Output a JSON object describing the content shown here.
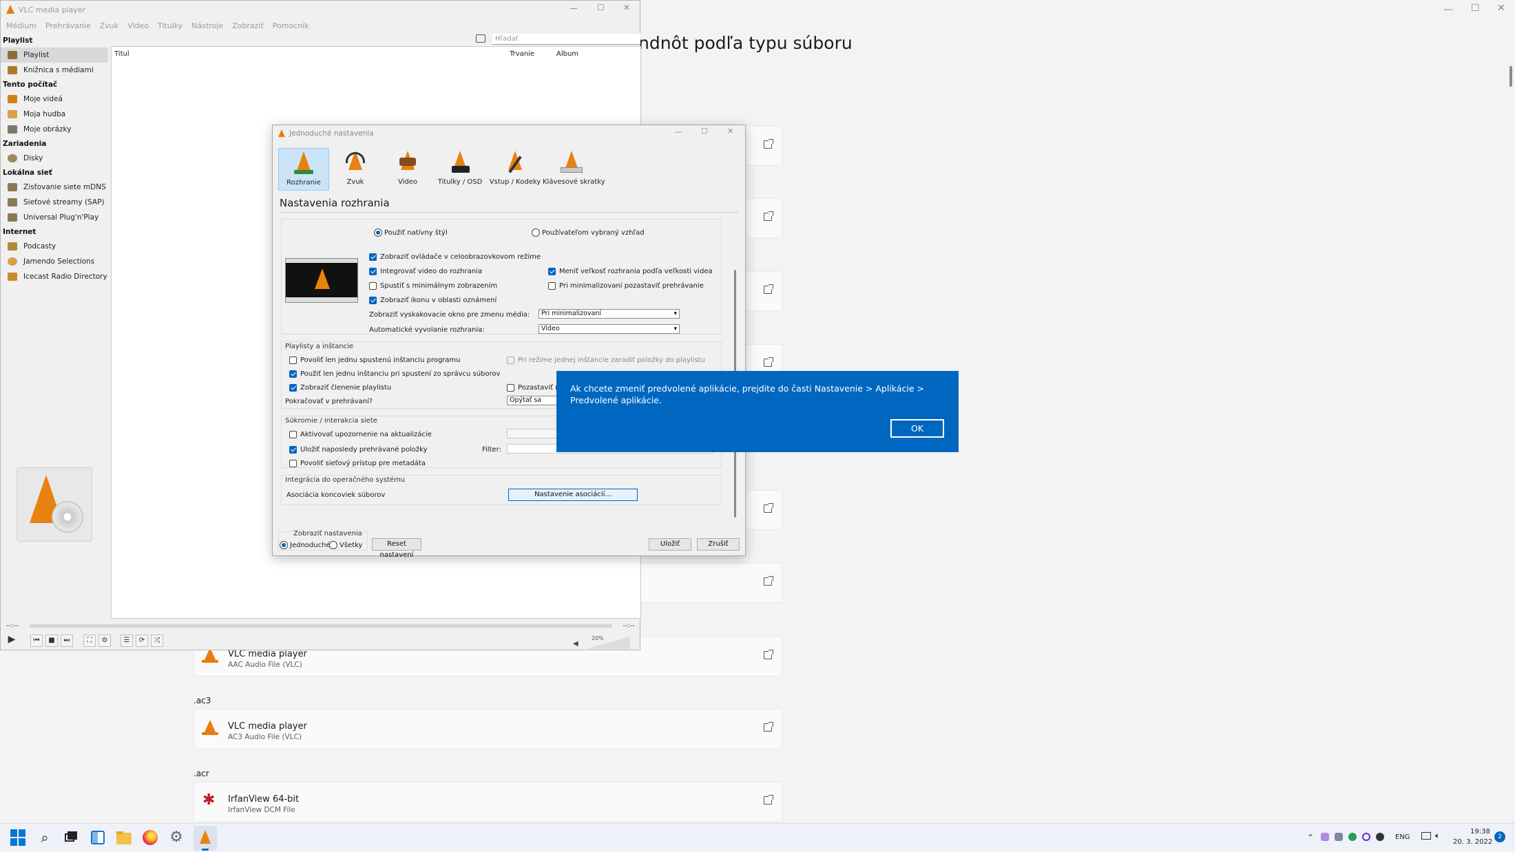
{
  "settings_bg": {
    "title": "ndnôt podľa typu súboru",
    "rows": [
      {
        "type": "row"
      },
      {
        "type": "row"
      },
      {
        "type": "row"
      },
      {
        "type": "row"
      },
      {
        "type": "row"
      },
      {
        "type": "row"
      },
      {
        "type": "row"
      }
    ],
    "row_aac": {
      "name": "VLC media player",
      "sub": "AAC Audio File (VLC)"
    },
    "header_ac3": ".ac3",
    "row_ac3": {
      "name": "VLC media player",
      "sub": "AC3 Audio File (VLC)"
    },
    "header_acr": ".acr",
    "row_acr": {
      "name": "IrfanView 64-bit",
      "sub": "IrfanView DCM File"
    }
  },
  "vlc": {
    "title": "VLC media player",
    "menu": [
      "Médium",
      "Prehrávanie",
      "Zvuk",
      "Video",
      "Titulky",
      "Nástroje",
      "Zobraziť",
      "Pomocník"
    ],
    "search_placeholder": "Hľadať",
    "sidebar": {
      "h_playlist": "Playlist",
      "playlist": "Playlist",
      "library": "Knižnica s médiami",
      "h_computer": "Tento počítač",
      "videos": "Moje videá",
      "music": "Moja hudba",
      "pictures": "Moje obrázky",
      "h_devices": "Zariadenia",
      "disks": "Disky",
      "h_lan": "Lokálna sieť",
      "mdns": "Zisťovanie siete mDNS",
      "sap": "Sieťové streamy (SAP)",
      "upnp": "Universal Plug'n'Play",
      "h_internet": "Internet",
      "podcasts": "Podcasty",
      "jamendo": "Jamendo Selections",
      "icecast": "Icecast Radio Directory"
    },
    "columns": [
      "Titul",
      "Trvanie",
      "Album"
    ],
    "time_left": "--:--",
    "time_right": "--:--",
    "volume": "20%"
  },
  "dialog": {
    "title": "Jednoduché nastavenia",
    "tabs": [
      "Rozhranie",
      "Zvuk",
      "Video",
      "Titulky / OSD",
      "Vstup / Kodeky",
      "Klávesové skratky"
    ],
    "heading": "Nastavenia rozhrania",
    "radio_native": "Použiť natívny štýl",
    "radio_custom": "Používateľom vybraný vzhľad",
    "cb_fullscreen": "Zobraziť ovládače v celoobrazovkovom režime",
    "cb_integrate": "Integrovať video do rozhrania",
    "cb_resize": "Meniť veľkosť rozhrania podľa veľkosti videa",
    "cb_minimal": "Spustiť s minimálnym zobrazením",
    "cb_pause_min": "Pri minimalizovaní pozastaviť prehrávanie",
    "cb_tray": "Zobraziť ikonu v oblasti oznámení",
    "popup_label": "Zobraziť vyskakovacie okno pre zmenu média:",
    "popup_value": "Pri minimalizovaní",
    "raise_label": "Automatické vyvolanie rozhrania:",
    "raise_value": "Video",
    "grp_playlist": "Playlisty a inštancie",
    "cb_one_instance": "Povoliť len jednu spustenú inštanciu programu",
    "cb_enqueue": "Pri režime jednej inštancie zaradiť položky do playlistu",
    "cb_one_instance_fm": "Použiť len jednu inštanciu pri spustení zo správcu súborov",
    "cb_tree": "Zobraziť členenie playlistu",
    "cb_pause": "Pozastaviť na",
    "continue_label": "Pokračovať v prehrávaní?",
    "continue_value": "Opýtať sa",
    "grp_privacy": "Súkromie / interakcia siete",
    "cb_updates": "Aktivovať upozornenie na aktualizácie",
    "cb_recent": "Uložiť naposledy prehrávané položky",
    "filter_label": "Filter:",
    "cb_metadata": "Povoliť sieťový prístup pre metadáta",
    "grp_os": "Integrácia do operačného systému",
    "assoc_label": "Asociácia koncoviek súborov",
    "assoc_button": "Nastavenie asociácií...",
    "show_settings": "Zobraziť nastavenia",
    "radio_simple": "Jednoduché",
    "radio_all": "Všetky",
    "reset": "Reset nastavení",
    "save": "Uložiť",
    "cancel": "Zrušiť"
  },
  "toast": {
    "message": "Ak chcete zmeniť predvolené aplikácie, prejdite do časti Nastavenie > Aplikácie > Predvolené aplikácie.",
    "ok": "OK"
  },
  "taskbar": {
    "lang": "ENG",
    "time": "19:38",
    "date": "20. 3. 2022",
    "badge": "2"
  },
  "colors": {
    "accent": "#0067c0",
    "vlc_orange": "#e87d0d"
  }
}
